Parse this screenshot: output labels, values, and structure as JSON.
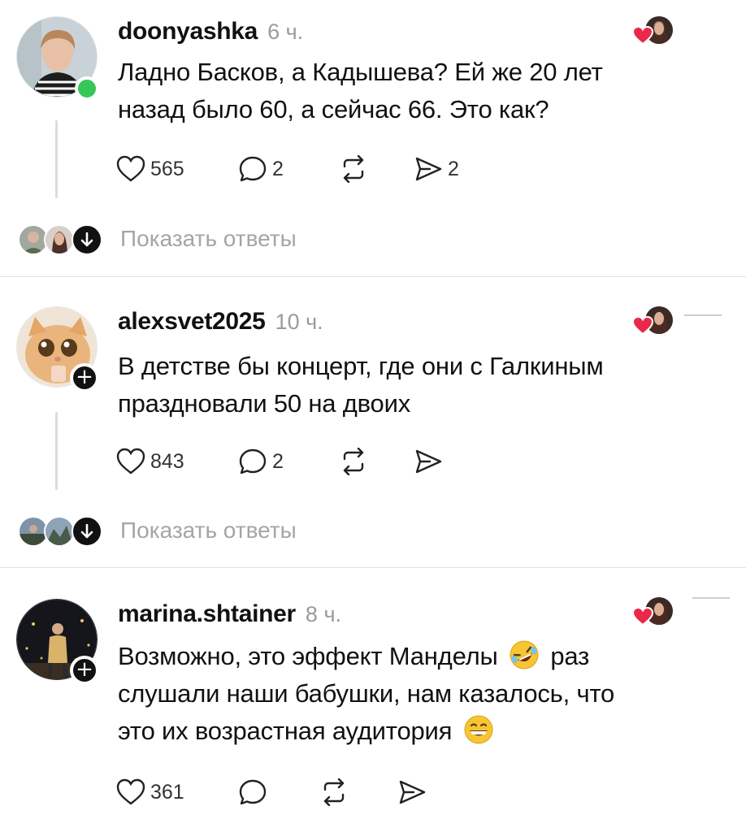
{
  "posts": [
    {
      "username": "doonyashka",
      "time": "6 ч.",
      "text_lines": [
        "Ладно Басков, а Кадышева? Ей же 20 лет",
        "назад было 60, а сейчас 66. Это как?"
      ],
      "likes": "565",
      "comments": "2",
      "reposts": "",
      "shares": "2",
      "show_replies": "Показать ответы",
      "badge": "online"
    },
    {
      "username": "alexsvet2025",
      "time": "10 ч.",
      "text_lines": [
        "В детстве бы концерт, где они с Галкиным",
        "праздновали 50 на двоих"
      ],
      "likes": "843",
      "comments": "2",
      "reposts": "",
      "shares": "",
      "show_replies": "Показать ответы",
      "badge": "follow",
      "follow_symbol": "+"
    },
    {
      "username": "marina.shtainer",
      "time": "8 ч.",
      "text_line1_a": "Возможно, это эффект Манделы",
      "text_line1_b": "раз",
      "text_line2": "слушали наши бабушки, нам казалось, что",
      "text_line3": "это их возрастная аудитория",
      "likes": "361",
      "comments": "",
      "reposts": "",
      "shares": "",
      "badge": "follow",
      "follow_symbol": "+"
    }
  ],
  "colors": {
    "text": "#111111",
    "muted": "#9a9a9a",
    "online": "#35c759",
    "like_heart": "#e8294a",
    "divider": "#e2e2e2"
  },
  "icons": [
    "heart-icon",
    "comment-icon",
    "repost-icon",
    "share-icon",
    "arrow-down-icon",
    "plus-icon",
    "rofl-emoji",
    "grin-emoji"
  ]
}
